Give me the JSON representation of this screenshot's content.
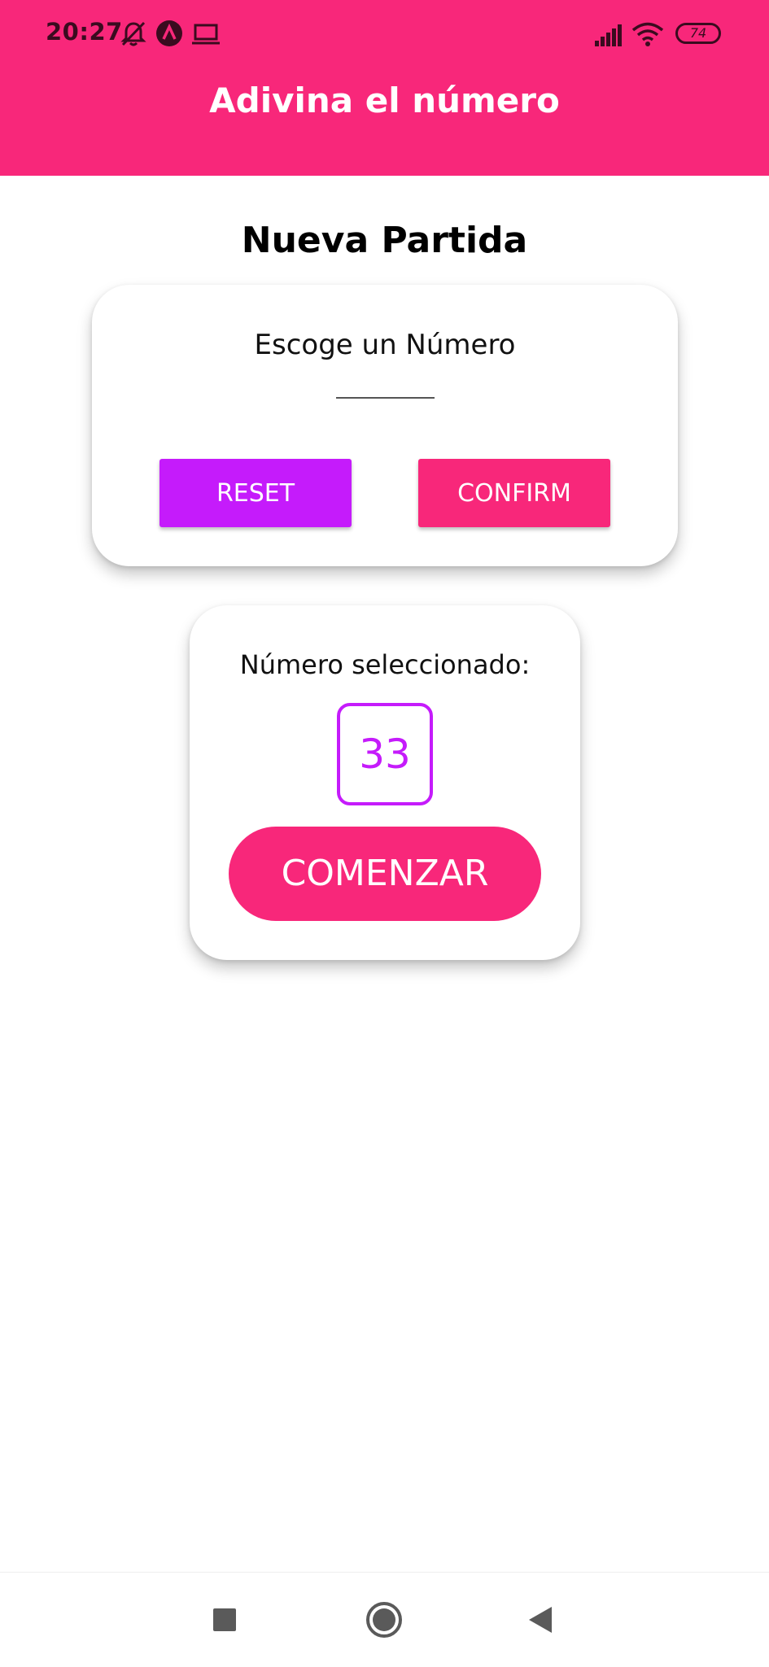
{
  "status_bar": {
    "time": "20:27",
    "battery": "74",
    "icons": [
      "notifications-off-icon",
      "app-notification-icon",
      "laptop-icon",
      "signal-icon",
      "wifi-icon",
      "battery-icon"
    ]
  },
  "app_bar": {
    "title": "Adivina el número"
  },
  "screen": {
    "title": "Nueva Partida"
  },
  "input_card": {
    "heading": "Escoge un Número",
    "input_value": "",
    "reset_label": "RESET",
    "confirm_label": "CONFIRM"
  },
  "selected_card": {
    "label": "Número seleccionado:",
    "number": "33",
    "start_label": "COMENZAR"
  },
  "nav_bar": {
    "icons": [
      "recent-apps-icon",
      "home-icon",
      "back-icon"
    ]
  },
  "colors": {
    "primary": "#F8277A",
    "accent": "#C51BFB",
    "background": "#FFFFFF"
  }
}
